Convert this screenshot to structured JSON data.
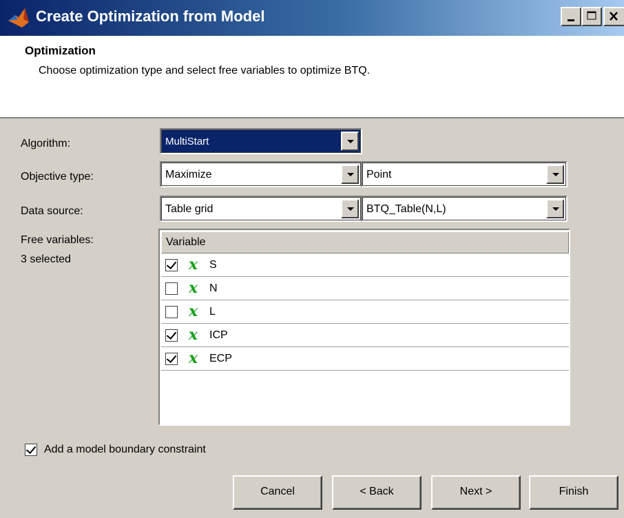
{
  "window": {
    "title": "Create Optimization from Model"
  },
  "header": {
    "title": "Optimization",
    "description": "Choose optimization type and select free variables to optimize BTQ."
  },
  "form": {
    "algorithm_label": "Algorithm:",
    "algorithm_value": "MultiStart",
    "objective_label": "Objective type:",
    "objective_value": "Maximize",
    "objective_point_value": "Point",
    "datasource_label": "Data source:",
    "datasource_value": "Table grid",
    "datasource_table_value": "BTQ_Table(N,L)",
    "free_vars_label": "Free variables:",
    "free_vars_count": "3 selected"
  },
  "variables": {
    "header": "Variable",
    "icon": "x",
    "rows": [
      {
        "name": "S",
        "checked": true
      },
      {
        "name": "N",
        "checked": false
      },
      {
        "name": "L",
        "checked": false
      },
      {
        "name": "ICP",
        "checked": true
      },
      {
        "name": "ECP",
        "checked": true
      }
    ]
  },
  "boundary": {
    "label": "Add a model boundary constraint",
    "checked": true
  },
  "buttons": {
    "cancel": "Cancel",
    "back": "< Back",
    "next": "Next >",
    "finish": "Finish"
  },
  "colors": {
    "titlebar_start": "#0a246a",
    "selection": "#0a246a",
    "variable_icon": "#18a018",
    "face": "#d4d0c8"
  }
}
